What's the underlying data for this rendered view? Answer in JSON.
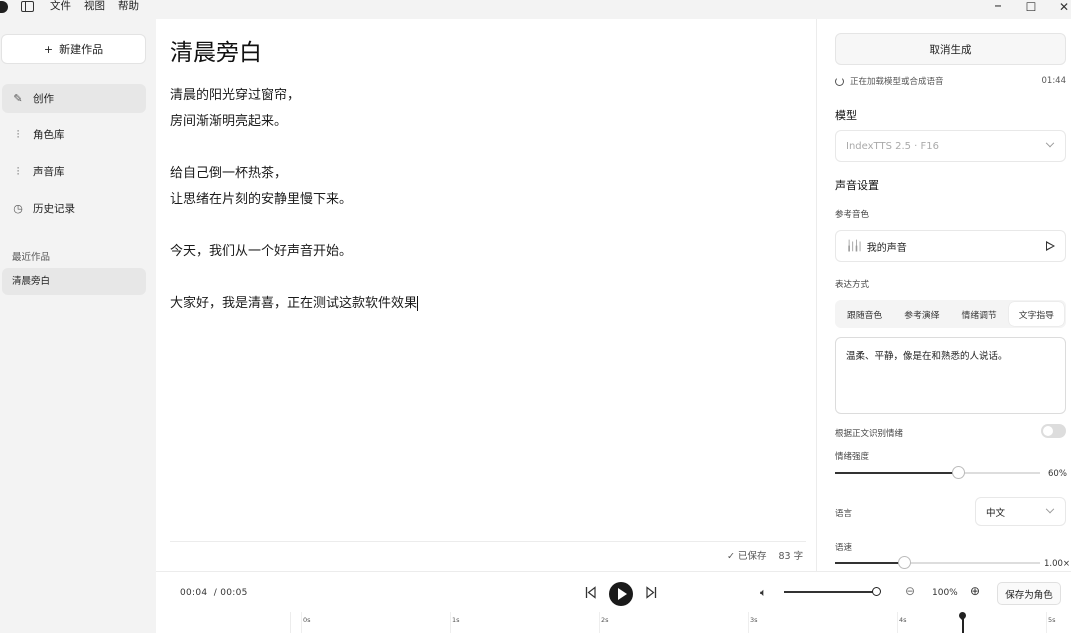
{
  "menu": {
    "file": "文件",
    "view": "视图",
    "help": "帮助"
  },
  "window": {
    "minimize": "–",
    "maximize": "☐",
    "close": "✕"
  },
  "sidebar": {
    "new_work": "新建作品",
    "new_work_icon": "plus-icon",
    "nav": [
      {
        "label": "创作",
        "icon": "pencil-icon"
      },
      {
        "label": "角色库",
        "icon": "waveform-icon"
      },
      {
        "label": "声音库",
        "icon": "waveform-icon"
      },
      {
        "label": "历史记录",
        "icon": "clock-icon"
      }
    ],
    "recent_label": "最近作品",
    "recent_items": [
      "清晨旁白"
    ]
  },
  "editor": {
    "title": "清晨旁白",
    "lines": [
      "清晨的阳光穿过窗帘，",
      "房间渐渐明亮起来。",
      "",
      "给自己倒一杯热茶，",
      "让思绪在片刻的安静里慢下来。",
      "",
      "今天，我们从一个好声音开始。",
      "",
      "大家好，我是清喜，正在测试这款软件效果"
    ],
    "save_status": "已保存",
    "char_count": "83 字"
  },
  "panel": {
    "cancel_button": "取消生成",
    "loading_text": "正在加载模型或合成语音",
    "loading_time": "01:44",
    "model_title": "模型",
    "model_value": "IndexTTS 2.5 · F16",
    "voice_settings_title": "声音设置",
    "reference_voice_label": "参考音色",
    "reference_voice_value": "我的声音",
    "expression_label": "表达方式",
    "expression_tabs": [
      "跟随音色",
      "参考演绎",
      "情绪调节",
      "文字指导"
    ],
    "expression_active": 3,
    "instruction_text": "温柔、平静，像是在和熟悉的人说话。",
    "auto_emotion_label": "根据正文识别情绪",
    "auto_emotion_on": false,
    "emotion_intensity_label": "情绪强度",
    "emotion_intensity_value": "60%",
    "emotion_intensity_fraction": 0.6,
    "language_label": "语言",
    "language_value": "中文",
    "speed_label": "语速",
    "speed_value": "1.00×",
    "speed_fraction": 0.34
  },
  "player": {
    "current_time": "00:04",
    "total_time": "/ 00:05",
    "volume_fraction": 1.0,
    "zoom_level": "100%",
    "save_as_role": "保存为角色",
    "ruler_ticks": [
      "0s",
      "1s",
      "2s",
      "3s",
      "4s",
      "5s"
    ]
  },
  "colors": {
    "accent": "#1a1a1a",
    "background": "#f3f3f3",
    "surface": "#ffffff"
  }
}
